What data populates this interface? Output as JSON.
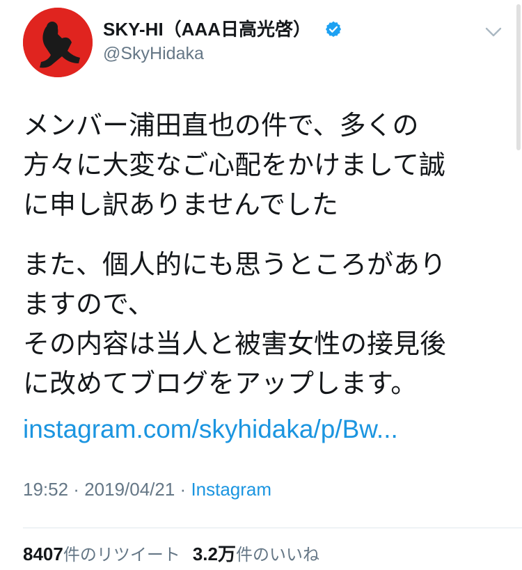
{
  "user": {
    "display_name": "SKY-HI（AAA日高光啓）",
    "handle": "@SkyHidaka",
    "verified": true
  },
  "tweet": {
    "paragraph1": [
      "メンバー浦田直也の件で、多くの",
      "方々に大変なご心配をかけまして誠",
      "に申し訳ありませんでした"
    ],
    "paragraph2": [
      "また、個人的にも思うところがあり",
      "ますので、",
      "その内容は当人と被害女性の接見後",
      "に改めてブログをアップします。"
    ],
    "link_text": "instagram.com/skyhidaka/p/Bw..."
  },
  "meta": {
    "time": "19:52",
    "separator": " · ",
    "date": "2019/04/21",
    "source": "Instagram"
  },
  "stats": {
    "retweets_count": "8407",
    "retweets_label": "件のリツイート",
    "likes_count": "3.2万",
    "likes_label": "件のいいね"
  },
  "icons": {
    "verified": "verified-badge-icon",
    "menu": "chevron-down-icon"
  },
  "colors": {
    "link": "#1b95e0",
    "secondary_text": "#657786",
    "primary_text": "#14171a",
    "verified": "#1da1f2",
    "avatar_bg": "#e0241f"
  }
}
